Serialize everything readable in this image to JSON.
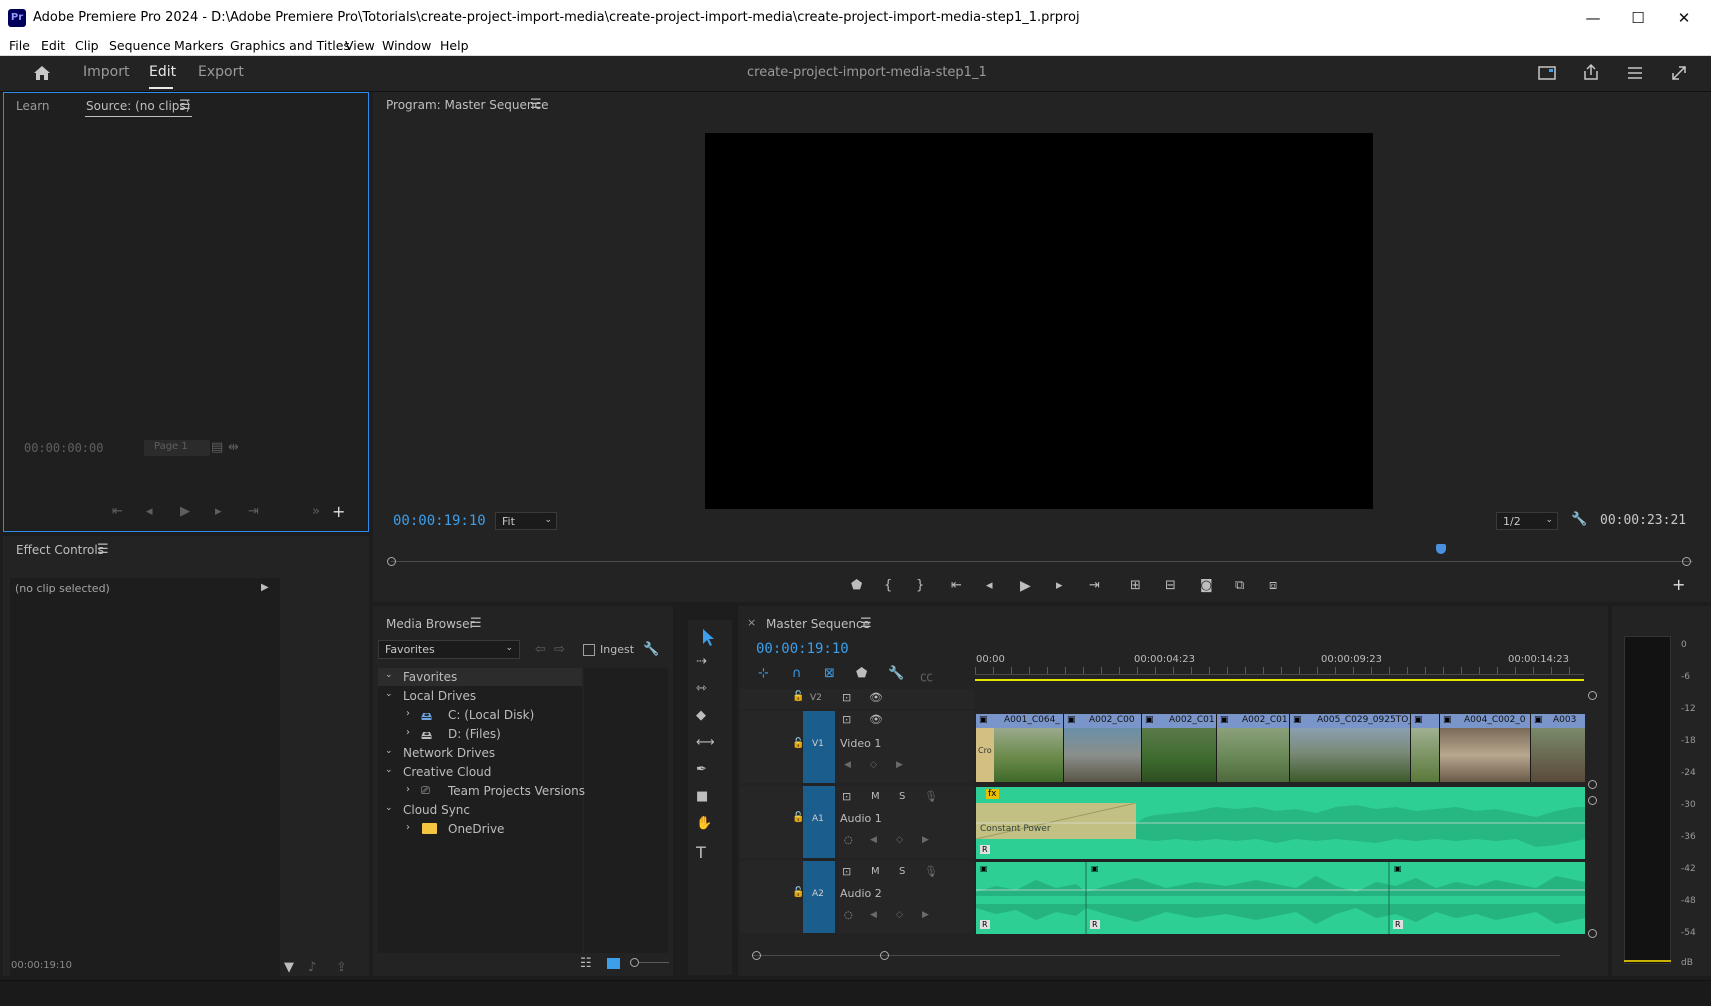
{
  "window": {
    "title": "Adobe Premiere Pro 2024 - D:\\Adobe Premiere Pro\\Totorials\\create-project-import-media\\create-project-import-media\\create-project-import-media-step1_1.prproj",
    "logo": "Pr",
    "minimize": "—",
    "maximize": "☐",
    "close": "✕"
  },
  "menu": [
    "File",
    "Edit",
    "Clip",
    "Sequence",
    "Markers",
    "Graphics and Titles",
    "View",
    "Window",
    "Help"
  ],
  "header": {
    "workspaces": [
      "Import",
      "Edit",
      "Export"
    ],
    "active_workspace": "Edit",
    "project_name": "create-project-import-media-step1_1"
  },
  "source_panel": {
    "tab_learn": "Learn",
    "tab_source": "Source: (no clips)",
    "timecode": "00:00:00:00",
    "page": "Page 1"
  },
  "program_panel": {
    "title": "Program: Master Sequence",
    "timecode": "00:00:19:10",
    "fit": "Fit",
    "resolution": "1/2",
    "duration": "00:00:23:21"
  },
  "effect_controls": {
    "title": "Effect Controls",
    "no_clip": "(no clip selected)",
    "timecode": "00:00:19:10"
  },
  "media_browser": {
    "title": "Media Browser",
    "dropdown": "Favorites",
    "ingest": "Ingest",
    "tree": [
      {
        "label": "Favorites",
        "level": 0
      },
      {
        "label": "Local Drives",
        "level": 0
      },
      {
        "label": "C: (Local Disk)",
        "level": 1
      },
      {
        "label": "D: (Files)",
        "level": 1
      },
      {
        "label": "Network Drives",
        "level": 0
      },
      {
        "label": "Creative Cloud",
        "level": 0
      },
      {
        "label": "Team Projects Versions",
        "level": 1
      },
      {
        "label": "Cloud Sync",
        "level": 0
      },
      {
        "label": "OneDrive",
        "level": 1
      }
    ]
  },
  "timeline": {
    "close": "×",
    "title": "Master Sequence",
    "timecode": "00:00:19:10",
    "ruler": [
      "00:00",
      "00:00:04:23",
      "00:00:09:23",
      "00:00:14:23"
    ],
    "tracks": {
      "v2": "V2",
      "v1": "V1",
      "v1_name": "Video 1",
      "a1": "A1",
      "a1_name": "Audio 1",
      "a2": "A2",
      "a2_name": "Audio 2"
    },
    "clips": [
      "A001_C064_",
      "A002_C00",
      "A002_C01",
      "A002_C01",
      "A005_C029_0925TO_",
      "A004_C002_0",
      "A003"
    ],
    "transition": "Constant Power",
    "transition_short": "Cro"
  },
  "meter": {
    "scale": [
      "0",
      "-6",
      "-12",
      "-18",
      "-24",
      "-30",
      "-36",
      "-42",
      "-48",
      "-54",
      "dB"
    ]
  },
  "colors": {
    "timecode_blue": "#3d9ee9",
    "audio_green": "#2ecf94",
    "track_blue": "#1b5d8c",
    "playhead": "#4a8fe0"
  }
}
